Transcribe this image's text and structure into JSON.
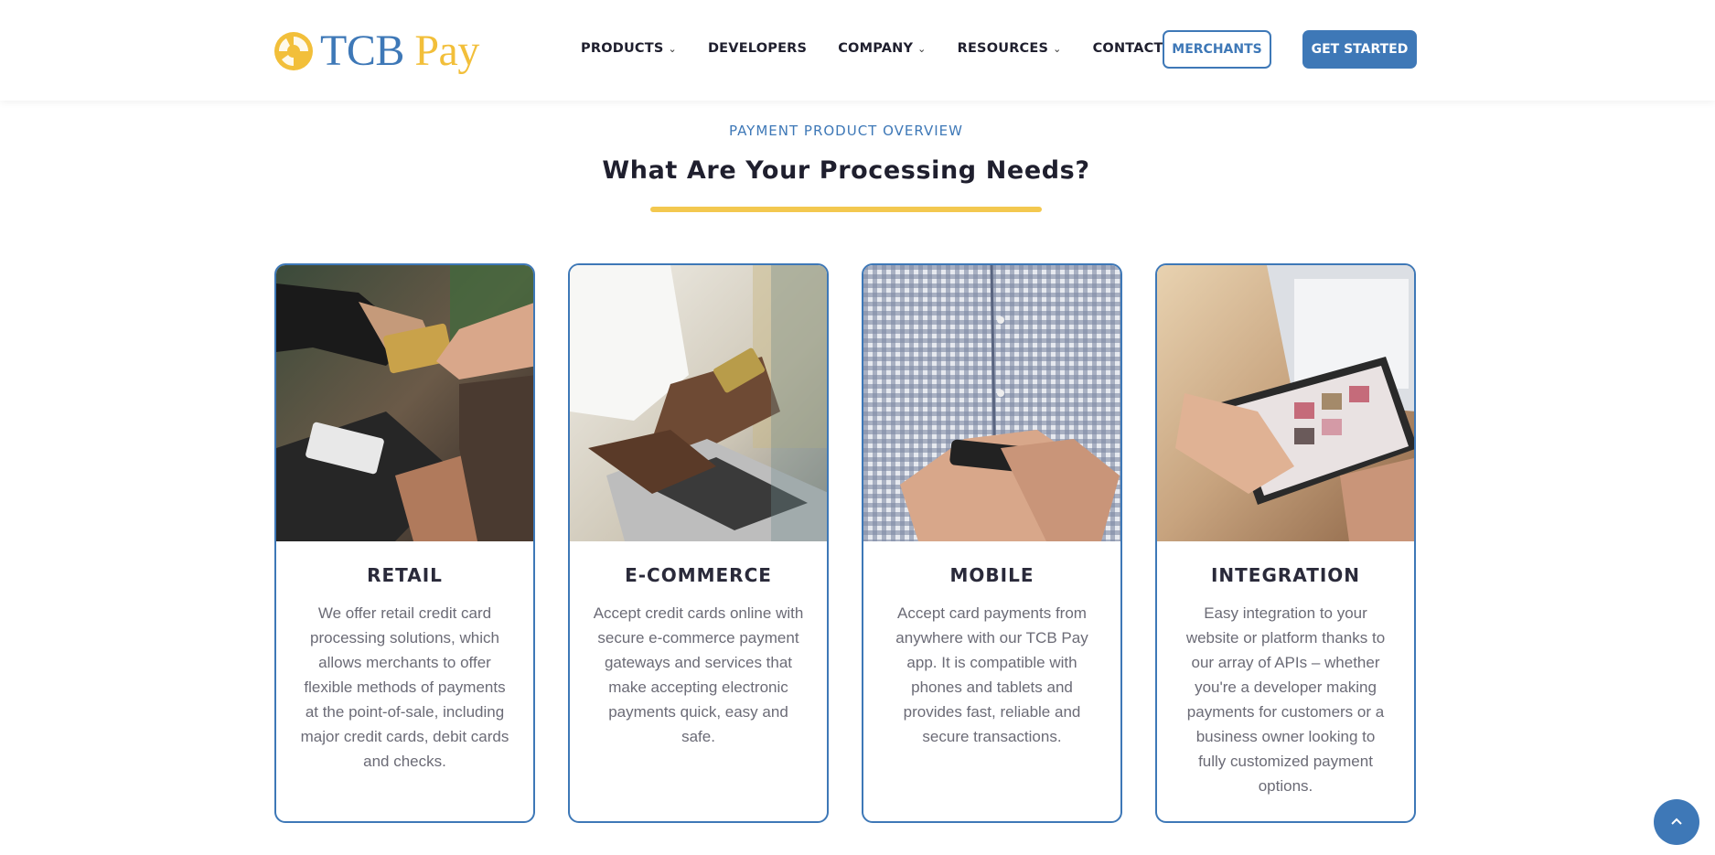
{
  "brand": {
    "name_part1": "TCB",
    "name_part2": "Pay"
  },
  "nav": {
    "items": [
      {
        "label": "PRODUCTS",
        "dropdown": true
      },
      {
        "label": "DEVELOPERS",
        "dropdown": false
      },
      {
        "label": "COMPANY",
        "dropdown": true
      },
      {
        "label": "RESOURCES",
        "dropdown": true
      },
      {
        "label": "CONTACT",
        "dropdown": false
      }
    ],
    "merchants_label": "MERCHANTS",
    "get_started_label": "GET STARTED"
  },
  "section": {
    "eyebrow": "PAYMENT PRODUCT OVERVIEW",
    "title": "What Are Your Processing Needs?"
  },
  "cards": [
    {
      "title": "RETAIL",
      "description": "We offer retail credit card processing solutions, which allows merchants to offer flexible methods of payments at the point-of-sale, including major credit cards, debit cards and checks."
    },
    {
      "title": "E-COMMERCE",
      "description": "Accept credit cards online with secure e-commerce payment gateways and services that make accepting electronic payments quick, easy and safe."
    },
    {
      "title": "MOBILE",
      "description": "Accept card payments from anywhere with our TCB Pay app. It is compatible with phones and tablets and provides fast, reliable and secure transactions."
    },
    {
      "title": "INTEGRATION",
      "description": "Easy integration to your website or platform thanks to our array of APIs – whether you're a developer making payments for customers or a business owner looking to fully customized payment options."
    }
  ],
  "colors": {
    "brand_blue": "#3e78b7",
    "brand_gold": "#f2bf3a",
    "underline_gold": "#f3c84f"
  },
  "icons": {
    "chevron": "chevron-down-icon",
    "scroll_top": "chevron-up-icon"
  }
}
